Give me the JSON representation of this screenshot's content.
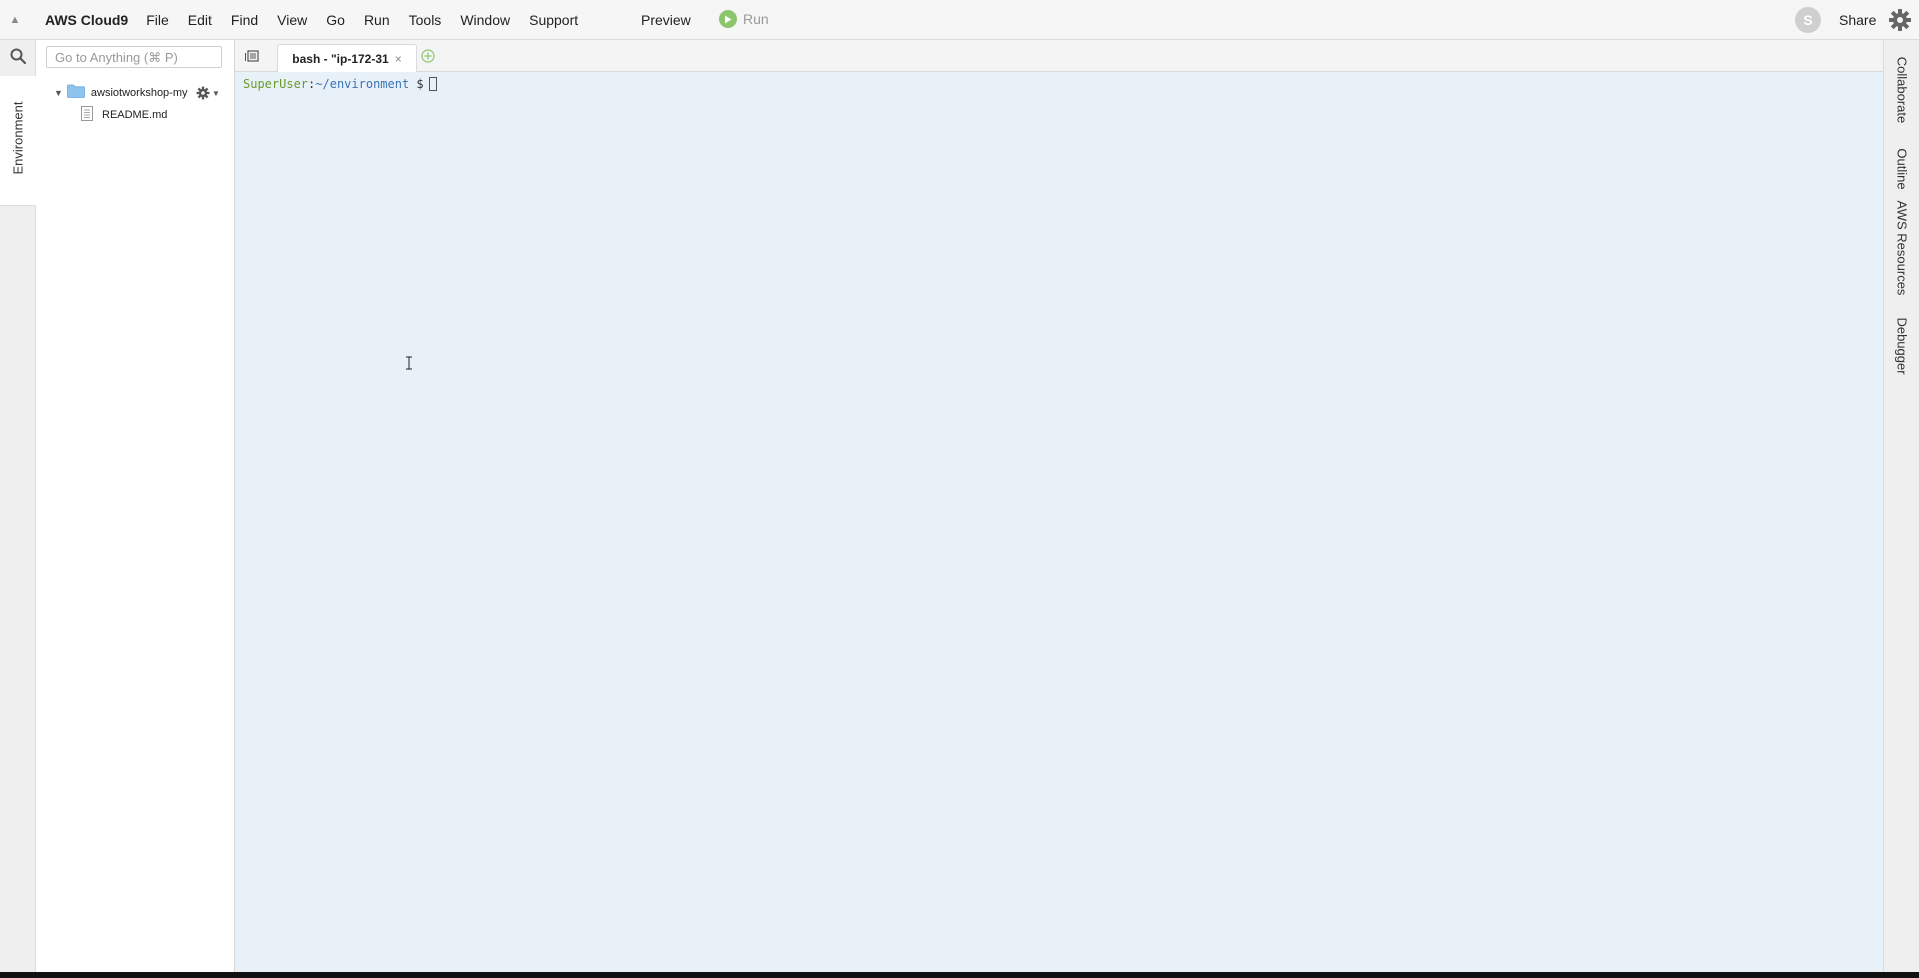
{
  "menubar": {
    "brand": "AWS Cloud9",
    "items": [
      "File",
      "Edit",
      "Find",
      "View",
      "Go",
      "Run",
      "Tools",
      "Window",
      "Support"
    ],
    "preview_label": "Preview",
    "run_label": "Run",
    "avatar_letter": "S",
    "share_label": "Share"
  },
  "left_strip": {
    "environment_tab": "Environment"
  },
  "tree": {
    "goto_placeholder": "Go to Anything (⌘ P)",
    "folder_name": "awsiotworkshop-my",
    "file_name": "README.md"
  },
  "tabs": [
    {
      "label": "bash - \"ip-172-31",
      "close": "×"
    }
  ],
  "terminal": {
    "user": "SuperUser",
    "colon": ":",
    "path": "~/environment",
    "dollar": " $"
  },
  "right_strip": {
    "tabs": [
      "Collaborate",
      "Outline",
      "AWS Resources",
      "Debugger"
    ]
  },
  "colors": {
    "terminal_bg": "#e8f0f8",
    "prompt_user": "#6a9a2a",
    "prompt_path": "#3b73b9",
    "run_icon": "#8cc56b"
  },
  "icons": [
    "collapse-arrow-icon",
    "play-icon",
    "gear-icon",
    "search-icon",
    "folder-icon",
    "file-icon",
    "tab-menu-icon",
    "add-tab-icon",
    "text-cursor-icon"
  ]
}
